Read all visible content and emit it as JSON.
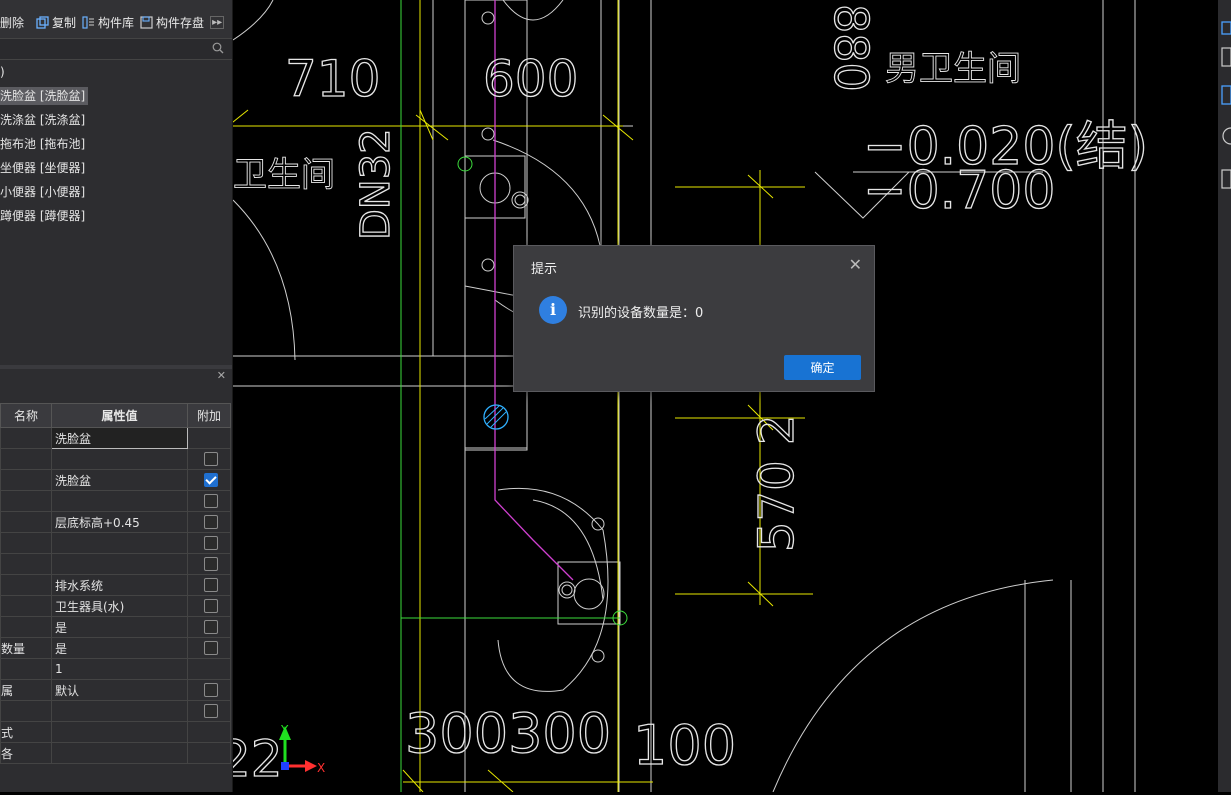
{
  "toolbar": {
    "items": [
      {
        "label": "删除",
        "icon": "delete-icon"
      },
      {
        "label": "复制",
        "icon": "copy-icon"
      },
      {
        "label": "构件库",
        "icon": "library-icon"
      },
      {
        "label": "构件存盘",
        "icon": "save-icon"
      }
    ]
  },
  "tree": {
    "root": ")",
    "items": [
      "洗脸盆 [洗脸盆]",
      "洗涤盆 [洗涤盆]",
      "拖布池 [拖布池]",
      "坐便器 [坐便器]",
      "小便器 [小便器]",
      "蹲便器 [蹲便器]"
    ]
  },
  "properties": {
    "headers": {
      "name": "名称",
      "value": "属性值",
      "extra": "附加"
    },
    "rows": [
      {
        "name": "",
        "value": "洗脸盆",
        "check": null
      },
      {
        "name": "",
        "value": "",
        "check": false
      },
      {
        "name": "",
        "value": "洗脸盆",
        "check": true
      },
      {
        "name": "",
        "value": "",
        "check": false
      },
      {
        "name": "",
        "value": "层底标高+0.45",
        "check": false
      },
      {
        "name": "",
        "value": "",
        "check": false
      },
      {
        "name": "",
        "value": "",
        "check": false
      },
      {
        "name": "",
        "value": "排水系统",
        "check": false
      },
      {
        "name": "",
        "value": "卫生器具(水)",
        "check": false
      },
      {
        "name": "",
        "value": "是",
        "check": false
      },
      {
        "name": "数量",
        "value": "是",
        "check": false
      },
      {
        "name": "",
        "value": "1",
        "check": null
      },
      {
        "name": "属",
        "value": "默认",
        "check": false
      },
      {
        "name": "",
        "value": "",
        "check": false
      },
      {
        "name": "式",
        "value": "",
        "check": null
      },
      {
        "name": "各",
        "value": "",
        "check": null
      }
    ]
  },
  "cad": {
    "texts": {
      "t710": "710",
      "t600": "600",
      "t880": "880",
      "men_wc": "男卫生间",
      "wc_left": "卫生间",
      "dn32": "DN32",
      "elev1": "−0.020(结)",
      "elev2": "−0.700",
      "t570": "570 2",
      "t300a": "300300",
      "t100": "100",
      "left_num": "22",
      "axis_x": "X",
      "axis_y": "Y"
    }
  },
  "dialog": {
    "title": "提示",
    "message": "识别的设备数量是：0",
    "ok_label": "确定",
    "info_glyph": "i"
  },
  "colors": {
    "accent": "#1873d3",
    "cad_yellow": "#e8e800",
    "cad_green": "#3cdc3c",
    "cad_magenta": "#d040d0",
    "cad_cyan": "#30b0ff"
  }
}
